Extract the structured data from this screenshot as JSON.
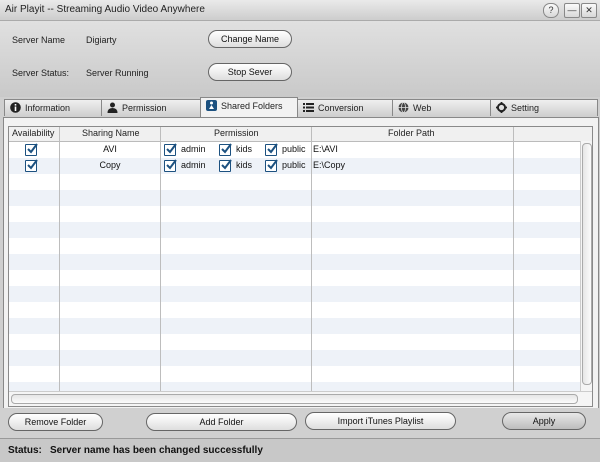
{
  "window": {
    "title": "Air Playit -- Streaming Audio Video Anywhere",
    "help": "?",
    "minimize": "—",
    "maximize": "□",
    "close": "✕"
  },
  "server": {
    "name_label": "Server Name",
    "name_value": "Digiarty",
    "change_name": "Change Name",
    "status_label": "Server Status:",
    "status_value": "Server Running",
    "stop_server": "Stop Sever"
  },
  "tabs": [
    {
      "label": "Information",
      "icon": "info-icon"
    },
    {
      "label": "Permission",
      "icon": "user-icon"
    },
    {
      "label": "Shared Folders",
      "icon": "shared-folder-icon",
      "active": true
    },
    {
      "label": "Conversion",
      "icon": "list-icon"
    },
    {
      "label": "Web",
      "icon": "globe-icon"
    },
    {
      "label": "Setting",
      "icon": "gear-icon"
    }
  ],
  "table": {
    "columns": [
      "Availability",
      "Sharing Name",
      "Permission",
      "Folder Path"
    ],
    "rows": [
      {
        "available": true,
        "name": "AVI",
        "admin_label": "admin",
        "admin": true,
        "kids_label": "kids",
        "kids": true,
        "public_label": "public",
        "public": true,
        "path": "E:\\AVI"
      },
      {
        "available": true,
        "name": "Copy",
        "admin_label": "admin",
        "admin": true,
        "kids_label": "kids",
        "kids": true,
        "public_label": "public",
        "public": true,
        "path": "E:\\Copy"
      }
    ]
  },
  "buttons": {
    "remove": "Remove Folder",
    "add": "Add Folder",
    "import": "Import iTunes Playlist",
    "apply": "Apply"
  },
  "status": {
    "label": "Status:",
    "message": "Server name has been changed successfully"
  },
  "colors": {
    "accent": "#1c5180",
    "row_alt": "#eef2f8",
    "background": "#cfcfcf"
  }
}
